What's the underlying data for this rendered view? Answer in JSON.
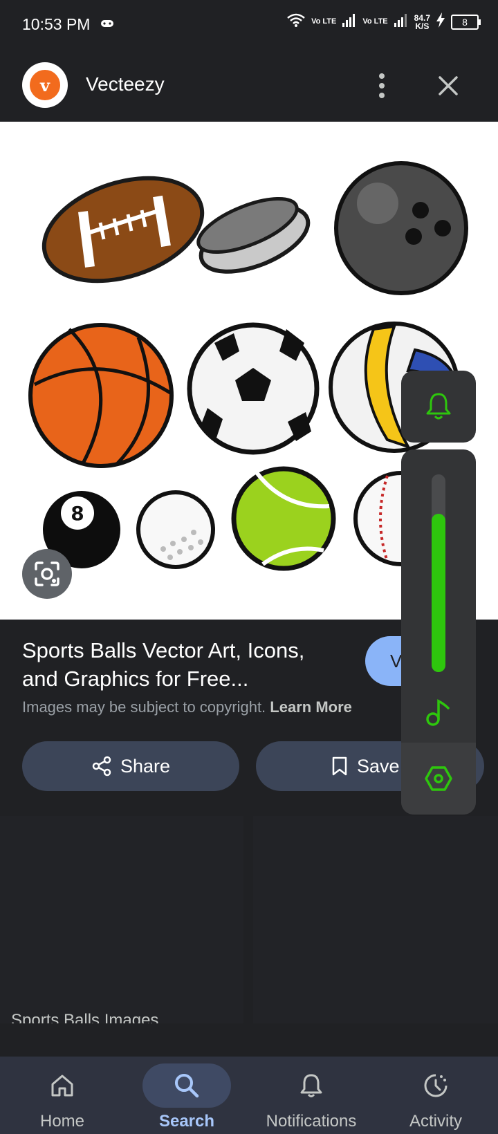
{
  "status_bar": {
    "time": "10:53 PM",
    "network_label_1": "Vo LTE",
    "network_label_2": "Vo LTE",
    "speed_value": "84.7",
    "speed_unit": "K/S",
    "battery": "8"
  },
  "header": {
    "site_name": "Vecteezy",
    "logo_letter": "v"
  },
  "result": {
    "title": "Sports Balls Vector Art, Icons, and Graphics for Free...",
    "visit_label": "V",
    "copyright_text": "Images may be subject to copyright.",
    "learn_more": "Learn More",
    "share_label": "Share",
    "save_label": "Save"
  },
  "related": {
    "caption": "Sports Balls Images"
  },
  "side_panel": {
    "volume_level": 0.8
  },
  "bottom_nav": {
    "items": [
      {
        "label": "Home",
        "icon": "home-icon"
      },
      {
        "label": "Search",
        "icon": "search-icon",
        "active": true
      },
      {
        "label": "Notifications",
        "icon": "bell-icon"
      },
      {
        "label": "Activity",
        "icon": "activity-icon"
      }
    ]
  },
  "colors": {
    "accent_green": "#2ec60d",
    "brand_orange": "#f26b1d",
    "active_blue": "#a8c7fa"
  }
}
